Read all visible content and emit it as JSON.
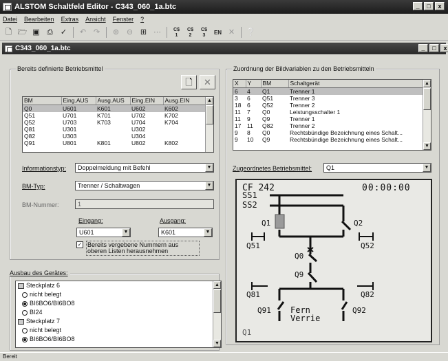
{
  "window": {
    "title": "ALSTOM Schaltfeld Editor - C343_060_1a.btc",
    "controls": [
      "_",
      "□",
      "x"
    ]
  },
  "menu": [
    "Datei",
    "Bearbeiten",
    "Extras",
    "Ansicht",
    "Fenster",
    "?"
  ],
  "toolbar": {
    "c1": "C$\n1",
    "c2": "C$\n2",
    "c3": "C$\n3",
    "en": "EN"
  },
  "document": {
    "title": "C343_060_1a.btc"
  },
  "left_panel": {
    "group_label": "Bereits definierte Betriebsmittel",
    "bm_table": {
      "headers": [
        "BM",
        "Eing.AUS",
        "Ausg.AUS",
        "Eing.EIN",
        "Ausg.EIN"
      ],
      "rows": [
        [
          "Q0",
          "U601",
          "K601",
          "U602",
          "K602"
        ],
        [
          "Q51",
          "U701",
          "K701",
          "U702",
          "K702"
        ],
        [
          "Q52",
          "U703",
          "K703",
          "U704",
          "K704"
        ],
        [
          "Q81",
          "U301",
          "",
          "U302",
          ""
        ],
        [
          "Q82",
          "U303",
          "",
          "U304",
          ""
        ],
        [
          "Q91",
          "U801",
          "K801",
          "U802",
          "K802"
        ]
      ]
    },
    "informationstyp": {
      "label": "Informationstyp:",
      "value": "Doppelmeldung mit Befehl"
    },
    "bm_typ": {
      "label": "BM-Typ:",
      "value": "Trenner / Schaltwagen"
    },
    "bm_nummer": {
      "label": "BM-Nummer:",
      "value": "1"
    },
    "eingang": {
      "label": "Eingang:",
      "value": "U601"
    },
    "ausgang": {
      "label": "Ausgang:",
      "value": "K601"
    },
    "checkbox_label": "Bereits vergebene Nummern aus oberen Listen herausnehmen"
  },
  "ausbau": {
    "label": "Ausbau des Gerätes:",
    "items": [
      {
        "type": "slot",
        "text": "Steckplatz 6"
      },
      {
        "type": "radio",
        "text": "nicht belegt",
        "checked": false
      },
      {
        "type": "radio",
        "text": "BI6BO6/BI6BO8",
        "checked": true
      },
      {
        "type": "radio",
        "text": "BI24",
        "checked": false
      },
      {
        "type": "slot",
        "text": "Steckplatz 7"
      },
      {
        "type": "radio",
        "text": "nicht belegt",
        "checked": false
      },
      {
        "type": "radio",
        "text": "BI6BO6/BI6BO8",
        "checked": true
      }
    ]
  },
  "right_panel": {
    "group_label": "Zuordnung der Bildvariablen zu den Betriebsmitteln",
    "headers": [
      "X",
      "Y",
      "BM",
      "Schaltgerät"
    ],
    "rows": [
      [
        "6",
        "4",
        "Q1",
        "Trenner 1"
      ],
      [
        "3",
        "6",
        "Q51",
        "Trenner 3"
      ],
      [
        "18",
        "6",
        "Q52",
        "Trenner 2"
      ],
      [
        "11",
        "7",
        "Q0",
        "Leistungsschalter 1"
      ],
      [
        "11",
        "9",
        "Q9",
        "Trenner 1"
      ],
      [
        "17",
        "11",
        "Q82",
        "Trenner 2"
      ],
      [
        "9",
        "8",
        "Q0",
        "Rechtsbündige Bezeichnung eines Schalt..."
      ],
      [
        "9",
        "10",
        "Q9",
        "Rechtsbündige Bezeichnung eines Schalt..."
      ]
    ],
    "zugeordnet": {
      "label": "Zugeordnetes Betriebsmittel:",
      "value": "Q1"
    }
  },
  "diagram": {
    "title": "CF 242",
    "time": "00:00:00",
    "ss1": "SS1",
    "ss2": "SS2",
    "q1": "Q1",
    "q2": "Q2",
    "q51": "Q51",
    "q52": "Q52",
    "q0": "Q0",
    "q9": "Q9",
    "q81": "Q81",
    "q82": "Q82",
    "q91": "Q91",
    "q92": "Q92",
    "fern": "Fern",
    "verrie": "Verrie",
    "footer": "Q1"
  },
  "status": {
    "text": "Bereit"
  }
}
